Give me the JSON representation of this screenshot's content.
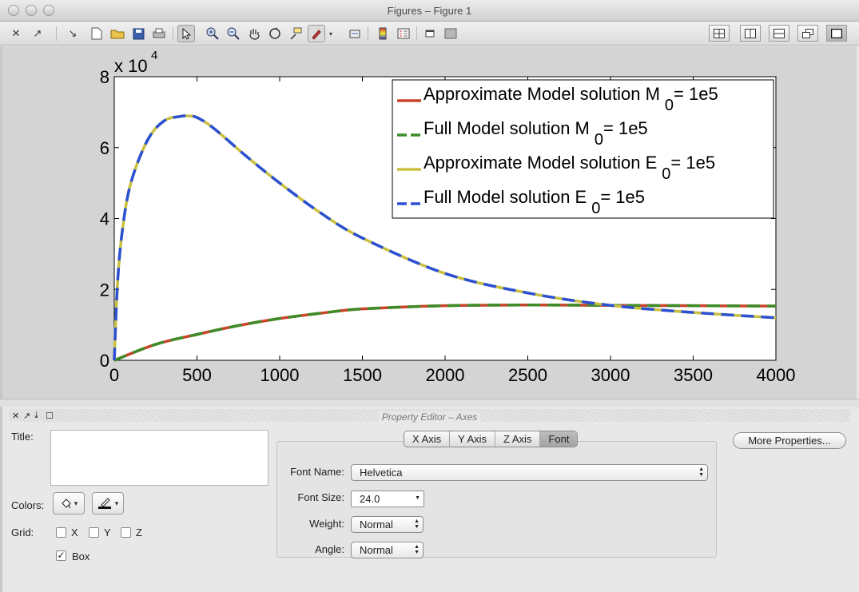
{
  "window": {
    "title": "Figures – Figure 1"
  },
  "toolbar": {
    "icons": [
      "close-icon",
      "undock-icon",
      "dock-icon",
      "new-figure-icon",
      "open-icon",
      "save-icon",
      "print-icon",
      "pointer-icon",
      "zoom-in-icon",
      "zoom-out-icon",
      "pan-icon",
      "rotate-icon",
      "data-cursor-icon",
      "brush-icon",
      "link-icon",
      "colorbar-icon",
      "legend-icon",
      "hide-tools-icon",
      "show-tools-icon"
    ],
    "layout_buttons": [
      "tile-grid-icon",
      "tile-columns-icon",
      "tile-rows-icon",
      "float-icon",
      "maximize-icon"
    ]
  },
  "chart_data": {
    "type": "line",
    "xlabel": "",
    "ylabel": "",
    "exponent_label": "x 10",
    "exponent_power": "4",
    "xlim": [
      0,
      4000
    ],
    "ylim": [
      0,
      80000
    ],
    "xticks": [
      "0",
      "500",
      "1000",
      "1500",
      "2000",
      "2500",
      "3000",
      "3500",
      "4000"
    ],
    "yticks": [
      "0",
      "2",
      "4",
      "6",
      "8"
    ],
    "legend_position": "top-right",
    "series": [
      {
        "name": "Approximate Model solution M",
        "subscript": "0",
        "suffix": " = 1e5",
        "color": "#c8442a",
        "style": "solid",
        "x": [
          0,
          250,
          500,
          750,
          1000,
          1250,
          1500,
          2000,
          2500,
          3000,
          3500,
          4000
        ],
        "y": [
          0,
          4500,
          7300,
          9800,
          11800,
          13300,
          14500,
          15400,
          15600,
          15500,
          15400,
          15300
        ]
      },
      {
        "name": "Full Model solution M",
        "subscript": "0",
        "suffix": " = 1e5",
        "color": "#3c8c28",
        "style": "dashed",
        "x": [
          0,
          250,
          500,
          750,
          1000,
          1250,
          1500,
          2000,
          2500,
          3000,
          3500,
          4000
        ],
        "y": [
          0,
          4500,
          7300,
          9800,
          11800,
          13300,
          14500,
          15400,
          15600,
          15500,
          15400,
          15300
        ]
      },
      {
        "name": "Approximate Model solution E",
        "subscript": "0",
        "suffix": " = 1e5",
        "color": "#c9c040",
        "style": "solid",
        "x": [
          0,
          20,
          50,
          100,
          200,
          300,
          400,
          450,
          500,
          600,
          800,
          1000,
          1250,
          1500,
          2000,
          2500,
          3000,
          3500,
          4000
        ],
        "y": [
          0,
          22000,
          37000,
          50000,
          62000,
          67500,
          68800,
          68900,
          68500,
          65500,
          57500,
          50000,
          41500,
          34500,
          24500,
          19000,
          15500,
          13500,
          12000
        ]
      },
      {
        "name": "Full Model solution E",
        "subscript": "0",
        "suffix": " = 1e5",
        "color": "#2c50d4",
        "style": "dashed",
        "x": [
          0,
          20,
          50,
          100,
          200,
          300,
          400,
          450,
          500,
          600,
          800,
          1000,
          1250,
          1500,
          2000,
          2500,
          3000,
          3500,
          4000
        ],
        "y": [
          0,
          22000,
          37000,
          50000,
          62000,
          67500,
          68800,
          68900,
          68500,
          65500,
          57500,
          50000,
          41500,
          34500,
          24500,
          19000,
          15500,
          13500,
          12000
        ]
      }
    ]
  },
  "property_editor": {
    "title": "Property Editor – Axes",
    "title_label": "Title:",
    "title_value": "",
    "colors_label": "Colors:",
    "grid_label": "Grid:",
    "grid_options": [
      {
        "label": "X",
        "checked": false
      },
      {
        "label": "Y",
        "checked": false
      },
      {
        "label": "Z",
        "checked": false
      }
    ],
    "box": {
      "label": "Box",
      "checked": true
    },
    "tabs": [
      "X Axis",
      "Y Axis",
      "Z Axis",
      "Font"
    ],
    "active_tab": "Font",
    "font_name_label": "Font Name:",
    "font_name": "Helvetica",
    "font_size_label": "Font Size:",
    "font_size": "24.0",
    "weight_label": "Weight:",
    "weight": "Normal",
    "angle_label": "Angle:",
    "angle": "Normal",
    "more_properties": "More Properties..."
  }
}
